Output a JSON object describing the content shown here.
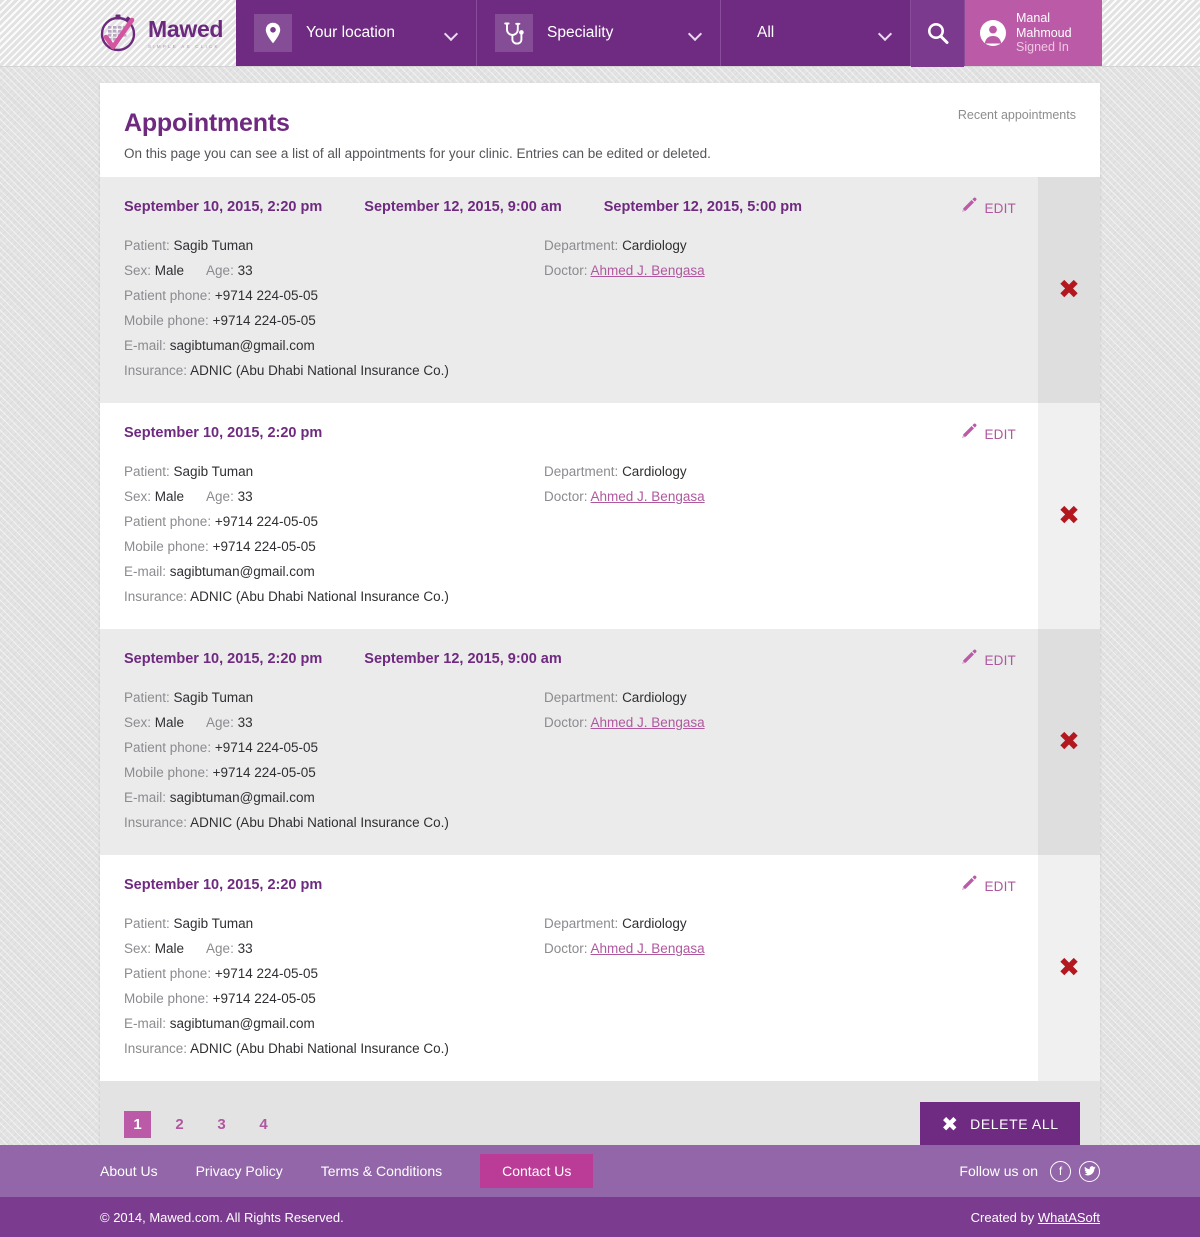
{
  "brand": {
    "name": "Mawed",
    "tagline": "SIMPLE AS CLICK",
    "logo_icon": "stopwatch-calendar-check-icon",
    "primary_color": "#6e2b81",
    "accent_color": "#bb5aa6"
  },
  "header": {
    "location": {
      "label": "Your location",
      "icon": "map-pin-icon"
    },
    "speciality": {
      "label": "Speciality",
      "icon": "stethoscope-icon"
    },
    "filter": {
      "label": "All"
    },
    "search": {
      "icon": "search-icon"
    },
    "user": {
      "name": "Manal Mahmoud",
      "status": "Signed In",
      "avatar_icon": "user-circle-icon"
    }
  },
  "page": {
    "title": "Appointments",
    "side_label": "Recent appointments",
    "description": "On this page you can see a list of all appointments for your clinic. Entries can be edited or deleted."
  },
  "labels": {
    "patient": "Patient:",
    "sex": "Sex:",
    "age": "Age:",
    "patient_phone": "Patient phone:",
    "mobile_phone": "Mobile phone:",
    "email": "E-mail:",
    "insurance": "Insurance:",
    "department": "Department:",
    "doctor": "Doctor:",
    "edit": "EDIT",
    "delete_icon": "close-x-icon",
    "edit_icon": "pencil-icon"
  },
  "appointments": [
    {
      "dates": [
        "September 10, 2015, 2:20 pm",
        "September 12, 2015, 9:00 am",
        "September 12, 2015, 5:00 pm"
      ],
      "patient": "Sagib Tuman",
      "sex": "Male",
      "age": "33",
      "patient_phone": "+9714 224-05-05",
      "mobile_phone": "+9714 224-05-05",
      "email": "sagibtuman@gmail.com",
      "insurance": "ADNIC (Abu Dhabi National Insurance Co.)",
      "department": "Cardiology",
      "doctor": "Ahmed J. Bengasa"
    },
    {
      "dates": [
        "September 10, 2015, 2:20 pm"
      ],
      "patient": "Sagib Tuman",
      "sex": "Male",
      "age": "33",
      "patient_phone": "+9714 224-05-05",
      "mobile_phone": "+9714 224-05-05",
      "email": "sagibtuman@gmail.com",
      "insurance": "ADNIC (Abu Dhabi National Insurance Co.)",
      "department": "Cardiology",
      "doctor": "Ahmed J. Bengasa"
    },
    {
      "dates": [
        "September 10, 2015, 2:20 pm",
        "September 12, 2015, 9:00 am"
      ],
      "patient": "Sagib Tuman",
      "sex": "Male",
      "age": "33",
      "patient_phone": "+9714 224-05-05",
      "mobile_phone": "+9714 224-05-05",
      "email": "sagibtuman@gmail.com",
      "insurance": "ADNIC (Abu Dhabi National Insurance Co.)",
      "department": "Cardiology",
      "doctor": "Ahmed J. Bengasa"
    },
    {
      "dates": [
        "September 10, 2015, 2:20 pm"
      ],
      "patient": "Sagib Tuman",
      "sex": "Male",
      "age": "33",
      "patient_phone": "+9714 224-05-05",
      "mobile_phone": "+9714 224-05-05",
      "email": "sagibtuman@gmail.com",
      "insurance": "ADNIC (Abu Dhabi National Insurance Co.)",
      "department": "Cardiology",
      "doctor": "Ahmed J. Bengasa"
    }
  ],
  "pagination": {
    "pages": [
      "1",
      "2",
      "3",
      "4"
    ],
    "active": "1"
  },
  "delete_all": {
    "label": "DELETE ALL",
    "icon": "close-x-icon"
  },
  "footer": {
    "links": [
      "About Us",
      "Privacy Policy",
      "Terms & Conditions"
    ],
    "contact": "Contact Us",
    "follow_label": "Follow us on",
    "social": [
      "facebook-icon",
      "twitter-icon"
    ],
    "copyright": "© 2014, Mawed.com. All Rights Reserved.",
    "credit_prefix": "Created by ",
    "credit_name": "WhatASoft"
  }
}
